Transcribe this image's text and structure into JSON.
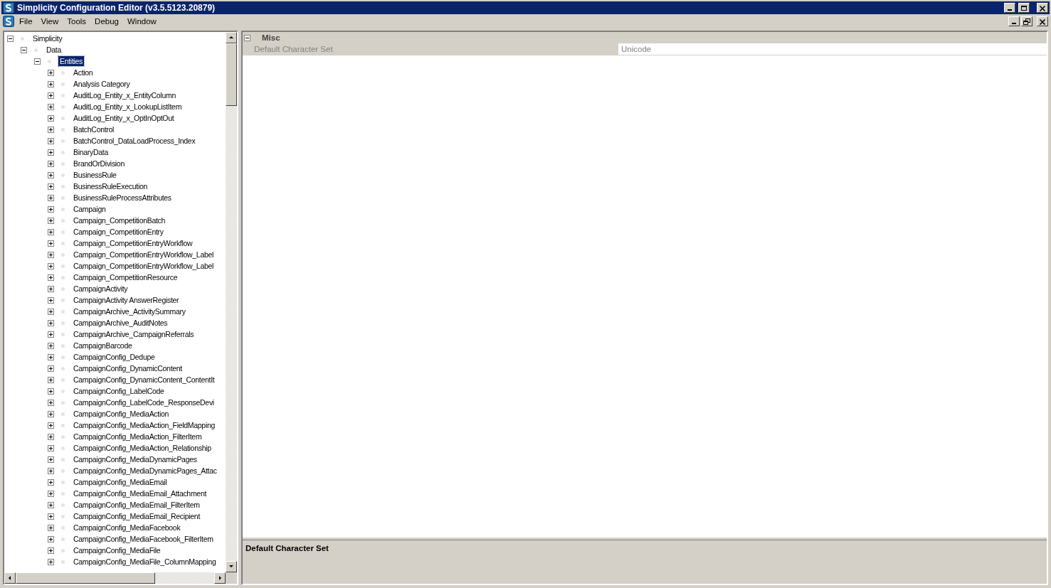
{
  "window": {
    "title": "Simplicity Configuration Editor (v3.5.5123.20879)"
  },
  "menu": [
    "File",
    "View",
    "Tools",
    "Debug",
    "Window"
  ],
  "tree": [
    {
      "label": "Simplicity",
      "expanded": true,
      "selected": false,
      "children": [
        {
          "label": "Data",
          "expanded": true,
          "selected": false,
          "children": [
            {
              "label": "Entities",
              "expanded": true,
              "selected": true,
              "children": [
                {
                  "label": "Action",
                  "expanded": false,
                  "selected": false
                },
                {
                  "label": "Analysis Category",
                  "expanded": false,
                  "selected": false
                },
                {
                  "label": "AuditLog_Entity_x_EntityColumn",
                  "expanded": false,
                  "selected": false
                },
                {
                  "label": "AuditLog_Entity_x_LookupListItem",
                  "expanded": false,
                  "selected": false
                },
                {
                  "label": "AuditLog_Entity_x_OptInOptOut",
                  "expanded": false,
                  "selected": false
                },
                {
                  "label": "BatchControl",
                  "expanded": false,
                  "selected": false
                },
                {
                  "label": "BatchControl_DataLoadProcess_Index",
                  "expanded": false,
                  "selected": false
                },
                {
                  "label": "BinaryData",
                  "expanded": false,
                  "selected": false
                },
                {
                  "label": "BrandOrDivision",
                  "expanded": false,
                  "selected": false
                },
                {
                  "label": "BusinessRule",
                  "expanded": false,
                  "selected": false
                },
                {
                  "label": "BusinessRuleExecution",
                  "expanded": false,
                  "selected": false
                },
                {
                  "label": "BusinessRuleProcessAttributes",
                  "expanded": false,
                  "selected": false
                },
                {
                  "label": "Campaign",
                  "expanded": false,
                  "selected": false
                },
                {
                  "label": "Campaign_CompetitionBatch",
                  "expanded": false,
                  "selected": false
                },
                {
                  "label": "Campaign_CompetitionEntry",
                  "expanded": false,
                  "selected": false
                },
                {
                  "label": "Campaign_CompetitionEntryWorkflow",
                  "expanded": false,
                  "selected": false
                },
                {
                  "label": "Campaign_CompetitionEntryWorkflow_Label",
                  "expanded": false,
                  "selected": false
                },
                {
                  "label": "Campaign_CompetitionEntryWorkflow_Label",
                  "expanded": false,
                  "selected": false
                },
                {
                  "label": "Campaign_CompetitionResource",
                  "expanded": false,
                  "selected": false
                },
                {
                  "label": "CampaignActivity",
                  "expanded": false,
                  "selected": false
                },
                {
                  "label": "CampaignActivity AnswerRegister",
                  "expanded": false,
                  "selected": false
                },
                {
                  "label": "CampaignArchive_ActivitySummary",
                  "expanded": false,
                  "selected": false
                },
                {
                  "label": "CampaignArchive_AuditNotes",
                  "expanded": false,
                  "selected": false
                },
                {
                  "label": "CampaignArchive_CampaignReferrals",
                  "expanded": false,
                  "selected": false
                },
                {
                  "label": "CampaignBarcode",
                  "expanded": false,
                  "selected": false
                },
                {
                  "label": "CampaignConfig_Dedupe",
                  "expanded": false,
                  "selected": false
                },
                {
                  "label": "CampaignConfig_DynamicContent",
                  "expanded": false,
                  "selected": false
                },
                {
                  "label": "CampaignConfig_DynamicContent_ContentIt",
                  "expanded": false,
                  "selected": false
                },
                {
                  "label": "CampaignConfig_LabelCode",
                  "expanded": false,
                  "selected": false
                },
                {
                  "label": "CampaignConfig_LabelCode_ResponseDevi",
                  "expanded": false,
                  "selected": false
                },
                {
                  "label": "CampaignConfig_MediaAction",
                  "expanded": false,
                  "selected": false
                },
                {
                  "label": "CampaignConfig_MediaAction_FieldMapping",
                  "expanded": false,
                  "selected": false
                },
                {
                  "label": "CampaignConfig_MediaAction_FilterItem",
                  "expanded": false,
                  "selected": false
                },
                {
                  "label": "CampaignConfig_MediaAction_Relationship",
                  "expanded": false,
                  "selected": false
                },
                {
                  "label": "CampaignConfig_MediaDynamicPages",
                  "expanded": false,
                  "selected": false
                },
                {
                  "label": "CampaignConfig_MediaDynamicPages_Attac",
                  "expanded": false,
                  "selected": false
                },
                {
                  "label": "CampaignConfig_MediaEmail",
                  "expanded": false,
                  "selected": false
                },
                {
                  "label": "CampaignConfig_MediaEmail_Attachment",
                  "expanded": false,
                  "selected": false
                },
                {
                  "label": "CampaignConfig_MediaEmail_FilterItem",
                  "expanded": false,
                  "selected": false
                },
                {
                  "label": "CampaignConfig_MediaEmail_Recipient",
                  "expanded": false,
                  "selected": false
                },
                {
                  "label": "CampaignConfig_MediaFacebook",
                  "expanded": false,
                  "selected": false
                },
                {
                  "label": "CampaignConfig_MediaFacebook_FilterItem",
                  "expanded": false,
                  "selected": false
                },
                {
                  "label": "CampaignConfig_MediaFile",
                  "expanded": false,
                  "selected": false
                },
                {
                  "label": "CampaignConfig_MediaFile_ColumnMapping",
                  "expanded": false,
                  "selected": false
                }
              ]
            }
          ]
        }
      ]
    }
  ],
  "properties": {
    "categories": [
      {
        "name": "Misc",
        "expanded": true,
        "items": [
          {
            "label": "Default Character Set",
            "value": "Unicode"
          }
        ]
      }
    ],
    "description": {
      "title": "Default Character Set"
    }
  }
}
